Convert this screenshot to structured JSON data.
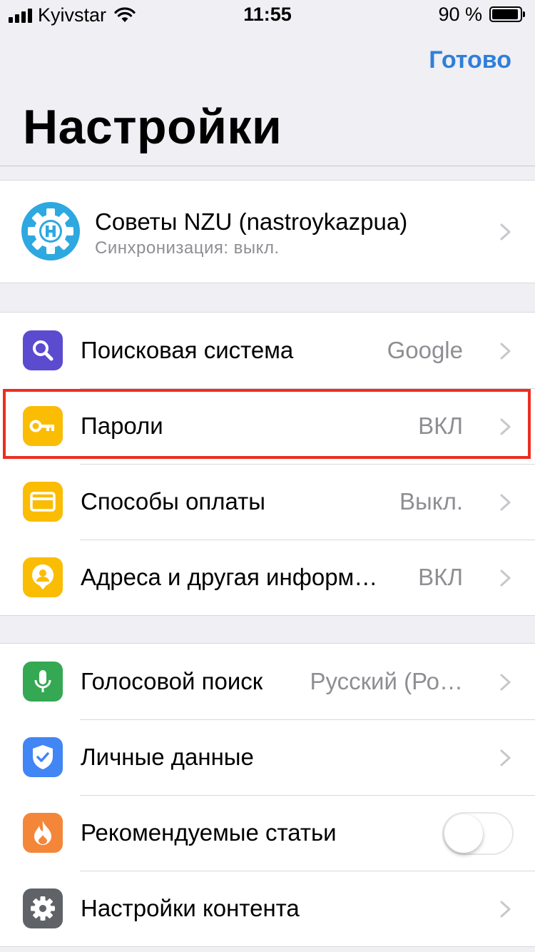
{
  "status_bar": {
    "carrier": "Kyivstar",
    "time": "11:55",
    "battery": "90 %",
    "battery_level": 0.9
  },
  "nav": {
    "done_label": "Готово",
    "title": "Настройки"
  },
  "account": {
    "name": "Советы NZU (nastroykazpua)",
    "sync_status": "Синхронизация: выкл.",
    "avatar_icon": "gear-h-logo",
    "avatar_color": "#2ea8e0"
  },
  "group1": {
    "items": [
      {
        "label": "Поисковая система",
        "value": "Google",
        "icon": "search-icon",
        "color": "#5b4bcf"
      },
      {
        "label": "Пароли",
        "value": "ВКЛ",
        "icon": "key-icon",
        "color": "#fbbc04",
        "highlighted": true
      },
      {
        "label": "Способы оплаты",
        "value": "Выкл.",
        "icon": "credit-card-icon",
        "color": "#fbbc04"
      },
      {
        "label": "Адреса и другая информ…",
        "value": "ВКЛ",
        "icon": "person-pin-icon",
        "color": "#fbbc04"
      }
    ]
  },
  "group2": {
    "items": [
      {
        "label": "Голосовой поиск",
        "value": "Русский (Ро…",
        "icon": "microphone-icon",
        "color": "#34a853"
      },
      {
        "label": "Личные данные",
        "value": "",
        "icon": "shield-check-icon",
        "color": "#4285f4"
      },
      {
        "label": "Рекомендуемые статьи",
        "value": "",
        "icon": "flame-icon",
        "color": "#f4863a",
        "toggle": false
      },
      {
        "label": "Настройки контента",
        "value": "",
        "icon": "gear-icon",
        "color": "#5f6368"
      }
    ]
  },
  "highlight_color": "#ec2e21",
  "accent_color": "#2f7fd9"
}
